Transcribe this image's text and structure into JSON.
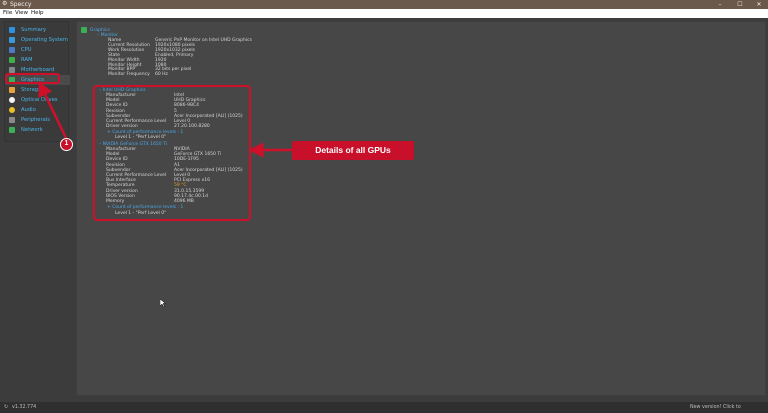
{
  "window": {
    "title": "Speccy",
    "buttons": {
      "minimize": "–",
      "maximize": "☐",
      "close": "✕"
    }
  },
  "menubar": {
    "file": "File",
    "view": "View",
    "help": "Help"
  },
  "sidebar": {
    "items": [
      {
        "label": "Summary",
        "icon": "summary-icon",
        "color": "#2f8fe0"
      },
      {
        "label": "Operating System",
        "icon": "windows-icon",
        "color": "#3a9ad9"
      },
      {
        "label": "CPU",
        "icon": "cpu-icon",
        "color": "#4a7bc4"
      },
      {
        "label": "RAM",
        "icon": "ram-icon",
        "color": "#3db04b"
      },
      {
        "label": "Motherboard",
        "icon": "motherboard-icon",
        "color": "#7f8c8d"
      },
      {
        "label": "Graphics",
        "icon": "graphics-icon",
        "color": "#3bb056"
      },
      {
        "label": "Storage",
        "icon": "storage-icon",
        "color": "#e6a23c"
      },
      {
        "label": "Optical Drives",
        "icon": "optical-drive-icon",
        "color": "#f4f4f4"
      },
      {
        "label": "Audio",
        "icon": "audio-icon",
        "color": "#e6c12c"
      },
      {
        "label": "Peripherals",
        "icon": "peripherals-icon",
        "color": "#8a8a8a"
      },
      {
        "label": "Network",
        "icon": "network-icon",
        "color": "#3bb056"
      }
    ]
  },
  "content": {
    "section_title": "Graphics",
    "monitor": {
      "header": "Monitor",
      "rows": [
        [
          "Name",
          "Generic PnP Monitor on Intel UHD Graphics"
        ],
        [
          "Current Resolution",
          "1920x1080 pixels"
        ],
        [
          "Work Resolution",
          "1920x1032 pixels"
        ],
        [
          "State",
          "Enabled, Primary"
        ],
        [
          "Monitor Width",
          "1920"
        ],
        [
          "Monitor Height",
          "1080"
        ],
        [
          "Monitor BPP",
          "32 bits per pixel"
        ],
        [
          "Monitor Frequency",
          "60 Hz"
        ]
      ]
    },
    "gpu1": {
      "header": "Intel UHD Graphics",
      "rows": [
        [
          "Manufacturer",
          "Intel"
        ],
        [
          "Model",
          "UHD Graphics"
        ],
        [
          "Device ID",
          "8086-9BC4"
        ],
        [
          "Revision",
          "5"
        ],
        [
          "Subvendor",
          "Acer Incorporated [ALI] (1025)"
        ],
        [
          "Current Performance Level",
          "Level 0"
        ],
        [
          "Driver version",
          "27.20.100.8280"
        ]
      ],
      "perf_header": "Count of performance levels : 1",
      "perf_level": "Level 1 - \"Perf Level 0\""
    },
    "gpu2": {
      "header": "NVIDIA GeForce GTX 1650 Ti",
      "rows": [
        [
          "Manufacturer",
          "NVIDIA"
        ],
        [
          "Model",
          "GeForce GTX 1650 Ti"
        ],
        [
          "Device ID",
          "10DE-1F95"
        ],
        [
          "Revision",
          "A1"
        ],
        [
          "Subvendor",
          "Acer Incorporated [ALI] (1025)"
        ],
        [
          "Current Performance Level",
          "Level 0"
        ],
        [
          "Bus Interface",
          "PCI Express x16"
        ],
        [
          "Temperature",
          "59 °C"
        ],
        [
          "Driver version",
          "31.0.15.3599"
        ],
        [
          "BIOS Version",
          "90.17.4c.00.1d"
        ],
        [
          "Memory",
          "4096 MB"
        ]
      ],
      "temperature_color": "#e0a020",
      "perf_header": "Count of performance levels : 1",
      "perf_level": "Level 1 - \"Perf Level 0\""
    }
  },
  "annotation": {
    "callout": "Details of all GPUs",
    "badge": "1",
    "accent": "#d0102b"
  },
  "statusbar": {
    "version": "v1.32.774",
    "update": "New version! Click to download..."
  }
}
